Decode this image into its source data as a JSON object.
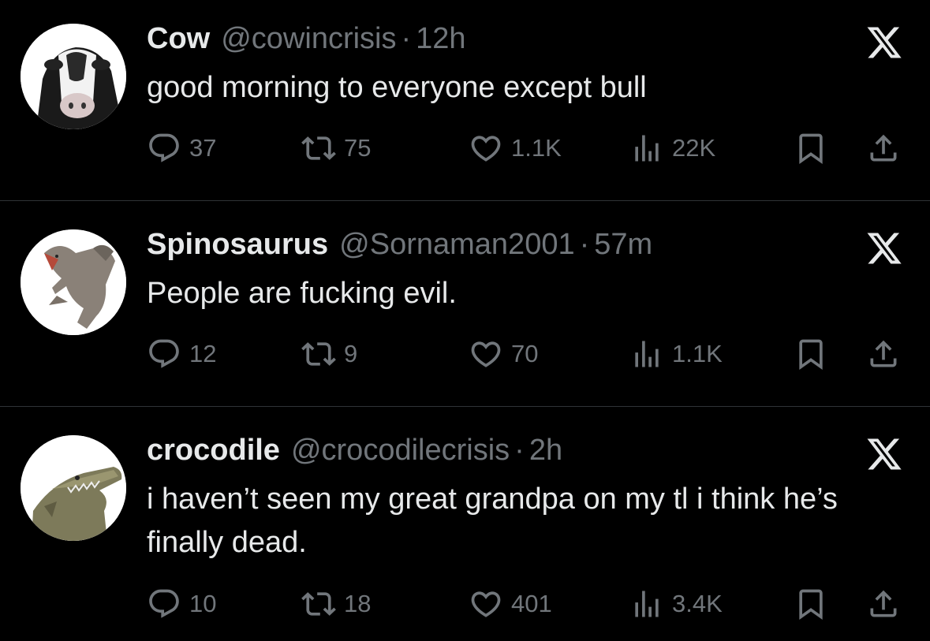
{
  "tweets": [
    {
      "name": "Cow",
      "handle": "@cowincrisis",
      "sep": "·",
      "time": "12h",
      "text": "good morning to everyone except bull",
      "reply_count": "37",
      "retweet_count": "75",
      "like_count": "1.1K",
      "view_count": "22K",
      "avatar": "cow-avatar"
    },
    {
      "name": "Spinosaurus",
      "handle": "@Sornaman2001",
      "sep": "·",
      "time": "57m",
      "text": "People are fucking evil.",
      "reply_count": "12",
      "retweet_count": "9",
      "like_count": "70",
      "view_count": "1.1K",
      "avatar": "spinosaurus-avatar"
    },
    {
      "name": "crocodile",
      "handle": "@crocodilecrisis",
      "sep": "·",
      "time": "2h",
      "text": "i haven’t seen my great grandpa on my tl i think he’s finally dead.",
      "reply_count": "10",
      "retweet_count": "18",
      "like_count": "401",
      "view_count": "3.4K",
      "avatar": "crocodile-avatar"
    }
  ],
  "icons": {
    "reply": "reply-icon",
    "retweet": "retweet-icon",
    "like": "heart-icon",
    "views": "views-icon",
    "bookmark": "bookmark-icon",
    "share": "share-icon",
    "brand": "x-logo-icon"
  },
  "colors": {
    "background": "#000000",
    "primary_text": "#e7e9ea",
    "secondary_text": "#71767b",
    "divider": "#2f3336"
  }
}
